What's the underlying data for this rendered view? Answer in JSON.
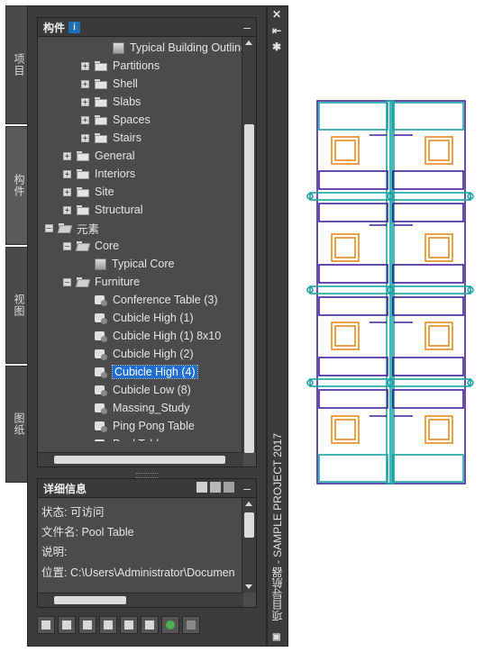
{
  "left_tabs": [
    {
      "label": "项目",
      "active": false
    },
    {
      "label": "构件",
      "active": true
    },
    {
      "label": "视图",
      "active": false
    },
    {
      "label": "图纸",
      "active": false
    }
  ],
  "components_panel": {
    "title": "构件",
    "info_icon": "i",
    "minimize": "–",
    "tree": [
      {
        "label": "Typical Building Outline",
        "level": 3,
        "icon": "building-icon",
        "expander": ""
      },
      {
        "label": "Partitions",
        "level": 2,
        "icon": "folder-icon",
        "expander": "+"
      },
      {
        "label": "Shell",
        "level": 2,
        "icon": "folder-icon",
        "expander": "+"
      },
      {
        "label": "Slabs",
        "level": 2,
        "icon": "folder-icon",
        "expander": "+"
      },
      {
        "label": "Spaces",
        "level": 2,
        "icon": "folder-icon",
        "expander": "+"
      },
      {
        "label": "Stairs",
        "level": 2,
        "icon": "folder-icon",
        "expander": "+"
      },
      {
        "label": "General",
        "level": 1,
        "icon": "folder-icon",
        "expander": "+"
      },
      {
        "label": "Interiors",
        "level": 1,
        "icon": "folder-icon",
        "expander": "+"
      },
      {
        "label": "Site",
        "level": 1,
        "icon": "folder-icon",
        "expander": "+"
      },
      {
        "label": "Structural",
        "level": 1,
        "icon": "folder-icon",
        "expander": "+"
      },
      {
        "label": "元素",
        "level": 0,
        "icon": "folder-open-icon",
        "expander": "–"
      },
      {
        "label": "Core",
        "level": 1,
        "icon": "folder-open-icon",
        "expander": "–"
      },
      {
        "label": "Typical Core",
        "level": 2,
        "icon": "building-icon",
        "expander": ""
      },
      {
        "label": "Furniture",
        "level": 1,
        "icon": "folder-open-icon",
        "expander": "–"
      },
      {
        "label": "Conference Table (3)",
        "level": 2,
        "icon": "component-icon",
        "expander": ""
      },
      {
        "label": "Cubicle High (1)",
        "level": 2,
        "icon": "component-icon",
        "expander": ""
      },
      {
        "label": "Cubicle High (1) 8x10",
        "level": 2,
        "icon": "component-icon",
        "expander": ""
      },
      {
        "label": "Cubicle High (2)",
        "level": 2,
        "icon": "component-icon",
        "expander": ""
      },
      {
        "label": "Cubicle High (4)",
        "level": 2,
        "icon": "component-icon",
        "expander": "",
        "selected": true
      },
      {
        "label": "Cubicle Low (8)",
        "level": 2,
        "icon": "component-icon",
        "expander": ""
      },
      {
        "label": "Massing_Study",
        "level": 2,
        "icon": "component-icon",
        "expander": ""
      },
      {
        "label": "Ping Pong Table",
        "level": 2,
        "icon": "component-icon",
        "expander": ""
      },
      {
        "label": "Pool Table",
        "level": 2,
        "icon": "component-icon",
        "expander": ""
      }
    ]
  },
  "details_panel": {
    "title": "详细信息",
    "minimize": "–",
    "rows": [
      "状态: 可访问",
      "文件名: Pool Table",
      "说明:",
      "位置: C:\\Users\\Administrator\\Documen"
    ]
  },
  "toolbar_icons": [
    "new-component-icon",
    "new-folder-icon",
    "new-element-icon",
    "copy-icon",
    "properties-icon",
    "grid-icon",
    "refresh-icon",
    "delete-icon"
  ],
  "side_strip": {
    "title": "项目导航器 - SAMPLE PROJECT 2017",
    "close": "✕",
    "pin": "⇤",
    "settings": "✱"
  },
  "colors": {
    "panel_bg": "#3c3c3c",
    "selection": "#1e6fd0",
    "wall_purple": "#3f1f9c",
    "desk_cyan": "#1aa3a3",
    "chair_orange": "#e88a1a"
  }
}
